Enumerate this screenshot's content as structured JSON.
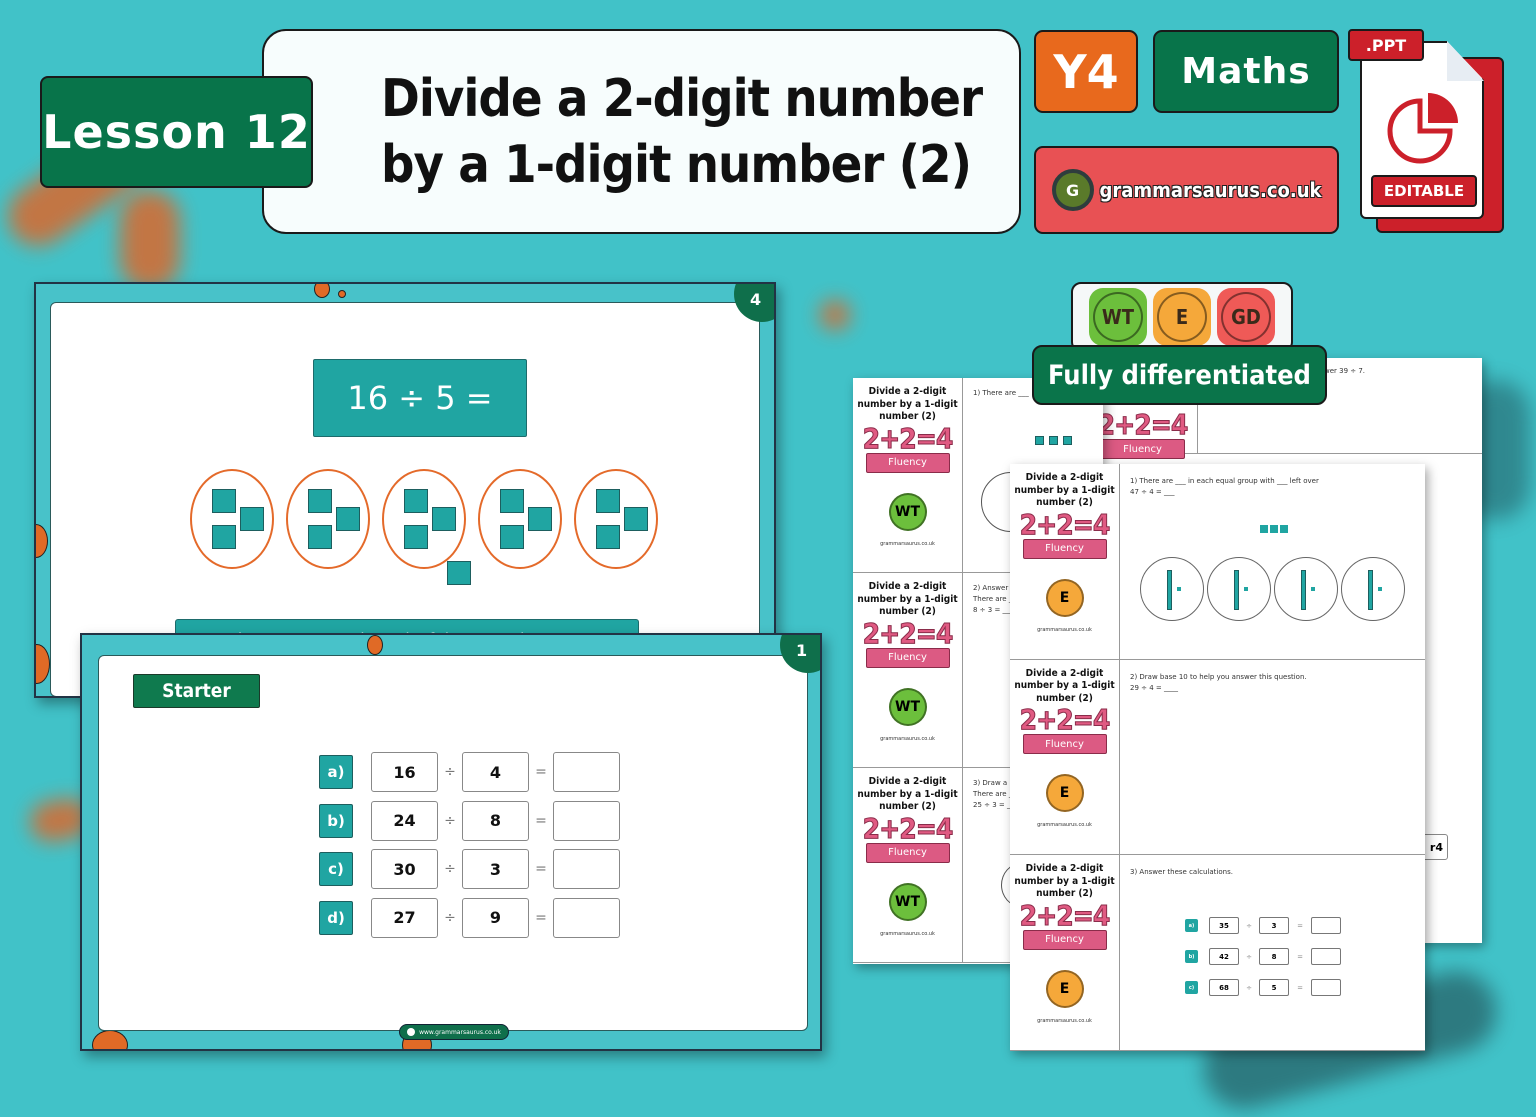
{
  "header": {
    "lesson_label": "Lesson 12",
    "title_line1": "Divide a 2-digit number",
    "title_line2": "by a 1-digit number (2)",
    "year_badge": "Y4",
    "subject_badge": "Maths",
    "brand_text": "grammarsaurus.co.uk",
    "brand_logo_letter": "G",
    "file_type_tag": ".PPT",
    "editable_tag": "EDITABLE"
  },
  "slide4": {
    "slide_number": "4",
    "equation": "16 ÷ 5 =",
    "groups": 5,
    "ones_per_group": 3,
    "remainder_cubes": 1,
    "caption": "There are 3 ones in each of the 5 equal groups."
  },
  "slide1": {
    "slide_number": "1",
    "section_tag": "Starter",
    "operator": "÷",
    "equals": "=",
    "questions": [
      {
        "label": "a)",
        "dividend": "16",
        "divisor": "4",
        "answer": ""
      },
      {
        "label": "b)",
        "dividend": "24",
        "divisor": "8",
        "answer": ""
      },
      {
        "label": "c)",
        "dividend": "30",
        "divisor": "3",
        "answer": ""
      },
      {
        "label": "d)",
        "dividend": "27",
        "divisor": "9",
        "answer": ""
      }
    ],
    "footer_url": "www.grammarsaurus.co.uk"
  },
  "differentiation": {
    "medals": [
      {
        "label": "WT",
        "color": "#6cbf3c"
      },
      {
        "label": "E",
        "color": "#f5a83a"
      },
      {
        "label": "GD",
        "color": "#ef5a57"
      }
    ],
    "label": "Fully differentiated"
  },
  "worksheets": {
    "sheet_title": "Divide a 2-digit number by a 1-digit number (2)",
    "fluency_equation": "2+2=4",
    "fluency_label": "Fluency",
    "brand_footer": "grammarsaurus.co.uk",
    "back_gd_partial_text": "wer 39 ÷ 7.",
    "back_gd_partial_answer": "r4",
    "wt_sheet": [
      {
        "medal": "WT",
        "question": "1) There are ___"
      },
      {
        "medal": "WT",
        "question": "2) Answer",
        "line2": "There are ___",
        "line3": "8 ÷ 3 = ___"
      },
      {
        "medal": "WT",
        "question": "3) Draw a",
        "line2": "There are ___",
        "line3": "25 ÷ 3 = ___"
      }
    ],
    "e_sheet": [
      {
        "medal": "E",
        "question": "1) There are ___ in each equal group with ___ left over",
        "line2": "47 ÷ 4 = ___"
      },
      {
        "medal": "E",
        "question": "2) Draw base 10 to help you answer this question.",
        "line2": "29 ÷ 4 = ____"
      },
      {
        "medal": "E",
        "question": "3) Answer these calculations.",
        "calcs": [
          {
            "label": "a)",
            "dividend": "35",
            "divisor": "3"
          },
          {
            "label": "b)",
            "dividend": "42",
            "divisor": "8"
          },
          {
            "label": "c)",
            "dividend": "68",
            "divisor": "5"
          }
        ]
      }
    ]
  }
}
